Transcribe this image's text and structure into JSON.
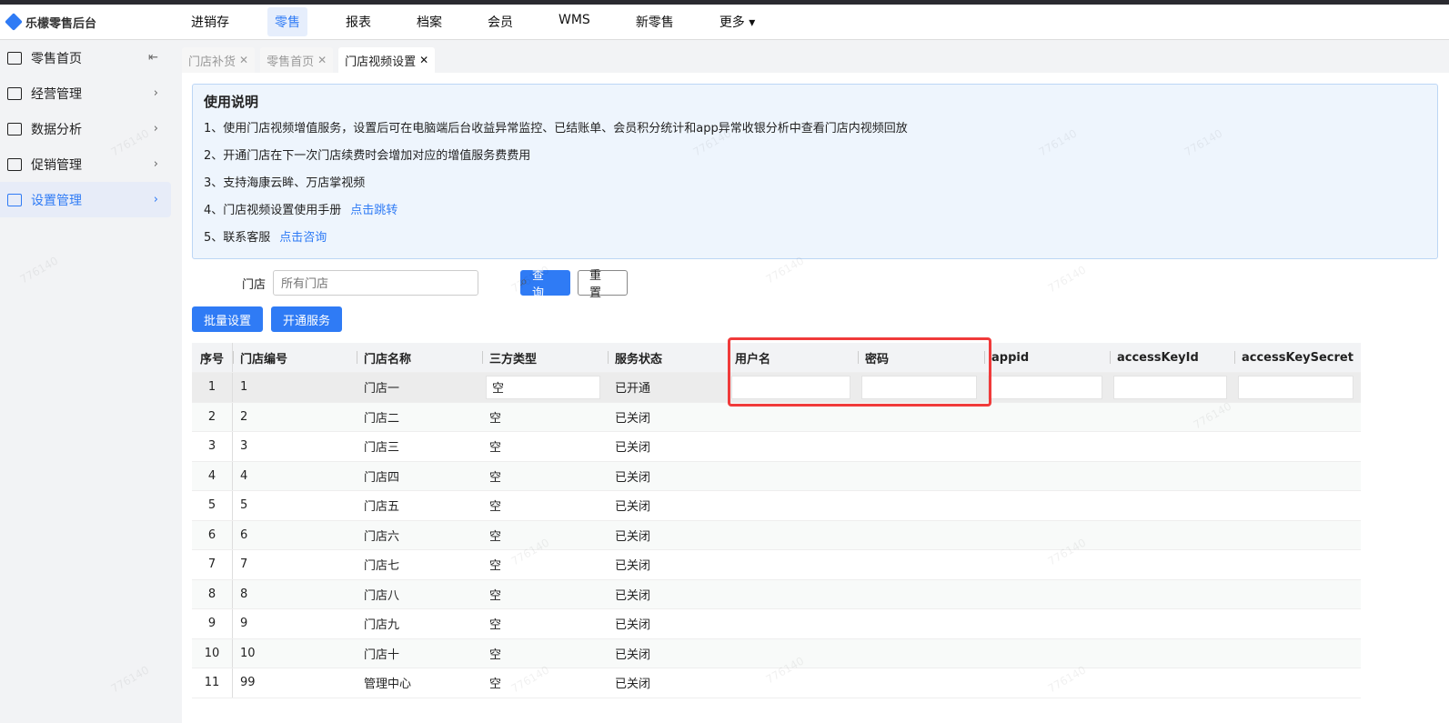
{
  "app": {
    "title": "乐檬零售后台"
  },
  "nav": [
    "进销存",
    "零售",
    "报表",
    "档案",
    "会员",
    "WMS",
    "新零售",
    "更多"
  ],
  "nav_active": "零售",
  "sidebar": [
    {
      "label": "零售首页"
    },
    {
      "label": "经营管理"
    },
    {
      "label": "数据分析"
    },
    {
      "label": "促销管理"
    },
    {
      "label": "设置管理"
    }
  ],
  "tabs": [
    {
      "label": "门店补货"
    },
    {
      "label": "零售首页"
    },
    {
      "label": "门店视频设置"
    }
  ],
  "info": {
    "title": "使用说明",
    "lines": [
      "1、使用门店视频增值服务，设置后可在电脑端后台收益异常监控、已结账单、会员积分统计和app异常收银分析中查看门店内视频回放",
      "2、开通门店在下一次门店续费时会增加对应的增值服务费费用",
      "3、支持海康云眸、万店掌视频",
      "4、门店视频设置使用手册",
      "5、联系客服"
    ],
    "link4": "点击跳转",
    "link5": "点击咨询"
  },
  "search": {
    "label": "门店",
    "placeholder": "所有门店",
    "query": "查 询",
    "reset": "重 置"
  },
  "actions": {
    "batch": "批量设置",
    "open": "开通服务"
  },
  "table": {
    "headers": [
      "序号",
      "门店编号",
      "门店名称",
      "三方类型",
      "服务状态",
      "用户名",
      "密码",
      "appid",
      "accessKeyId",
      "accessKeySecret"
    ],
    "rows": [
      [
        "1",
        "1",
        "门店一",
        "空",
        "已开通"
      ],
      [
        "2",
        "2",
        "门店二",
        "空",
        "已关闭"
      ],
      [
        "3",
        "3",
        "门店三",
        "空",
        "已关闭"
      ],
      [
        "4",
        "4",
        "门店四",
        "空",
        "已关闭"
      ],
      [
        "5",
        "5",
        "门店五",
        "空",
        "已关闭"
      ],
      [
        "6",
        "6",
        "门店六",
        "空",
        "已关闭"
      ],
      [
        "7",
        "7",
        "门店七",
        "空",
        "已关闭"
      ],
      [
        "8",
        "8",
        "门店八",
        "空",
        "已关闭"
      ],
      [
        "9",
        "9",
        "门店九",
        "空",
        "已关闭"
      ],
      [
        "10",
        "10",
        "门店十",
        "空",
        "已关闭"
      ],
      [
        "11",
        "99",
        "管理中心",
        "空",
        "已关闭"
      ]
    ]
  },
  "watermark": "776140"
}
